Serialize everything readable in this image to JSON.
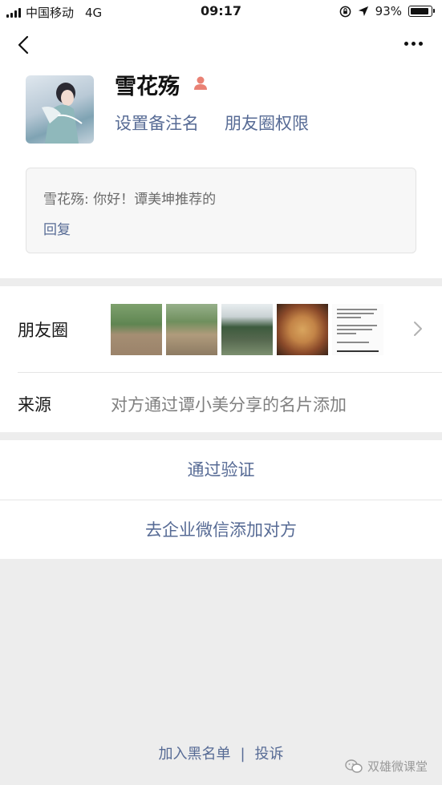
{
  "status_bar": {
    "carrier": "中国移动",
    "network": "4G",
    "time": "09:17",
    "battery_percent": "93%",
    "battery_level": 0.93
  },
  "profile": {
    "nickname": "雪花殇",
    "gender_icon": "female-icon",
    "gender_color": "#e98174",
    "set_remark_label": "设置备注名",
    "moments_permission_label": "朋友圈权限"
  },
  "message": {
    "text": "雪花殇: 你好！谭美坤推荐的",
    "reply_label": "回复"
  },
  "info": {
    "moments_label": "朋友圈",
    "source_label": "来源",
    "source_value": "对方通过谭小美分享的名片添加"
  },
  "actions": {
    "verify_label": "通过验证",
    "enterprise_label": "去企业微信添加对方"
  },
  "footer": {
    "blacklist_label": "加入黑名单",
    "separator": "|",
    "report_label": "投诉"
  },
  "watermark": {
    "text": "双雄微课堂"
  },
  "colors": {
    "link": "#576b95",
    "background": "#ededed",
    "card": "#ffffff"
  }
}
